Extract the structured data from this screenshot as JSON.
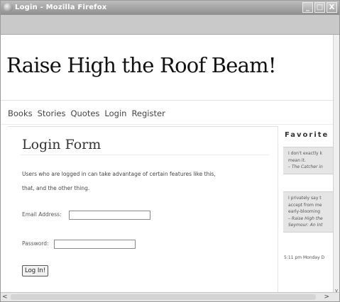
{
  "window": {
    "title": "Login - Mozilla Firefox",
    "minimize_glyph": "_",
    "maximize_glyph": "□",
    "close_glyph": "X"
  },
  "site": {
    "title": "Raise High the Roof Beam!"
  },
  "nav": {
    "items": [
      "Books",
      "Stories",
      "Quotes",
      "Login",
      "Register"
    ]
  },
  "login_form": {
    "heading": "Login Form",
    "intro_line1": "Users who are logged in can take advantage of certain features like this,",
    "intro_line2": "that, and the other thing.",
    "email_label": "Email Address:",
    "email_value": "",
    "password_label": "Password:",
    "password_value": "",
    "submit_label": "Log In!"
  },
  "sidebar": {
    "heading": "Favorite",
    "quote1": {
      "line1": "I don't exactly k",
      "line2": "mean it.",
      "cite": "– The Catcher in"
    },
    "quote2": {
      "line1": "I privately say t",
      "line2": "accept from me",
      "line3": "early-blooming",
      "cite1": "– Raise High the",
      "cite2": "Seymour: An Int"
    },
    "timestamp": "5:11 pm Monday D"
  },
  "scrollbars": {
    "left_arrow": "<",
    "right_arrow": ">",
    "down_arrow": "v"
  }
}
